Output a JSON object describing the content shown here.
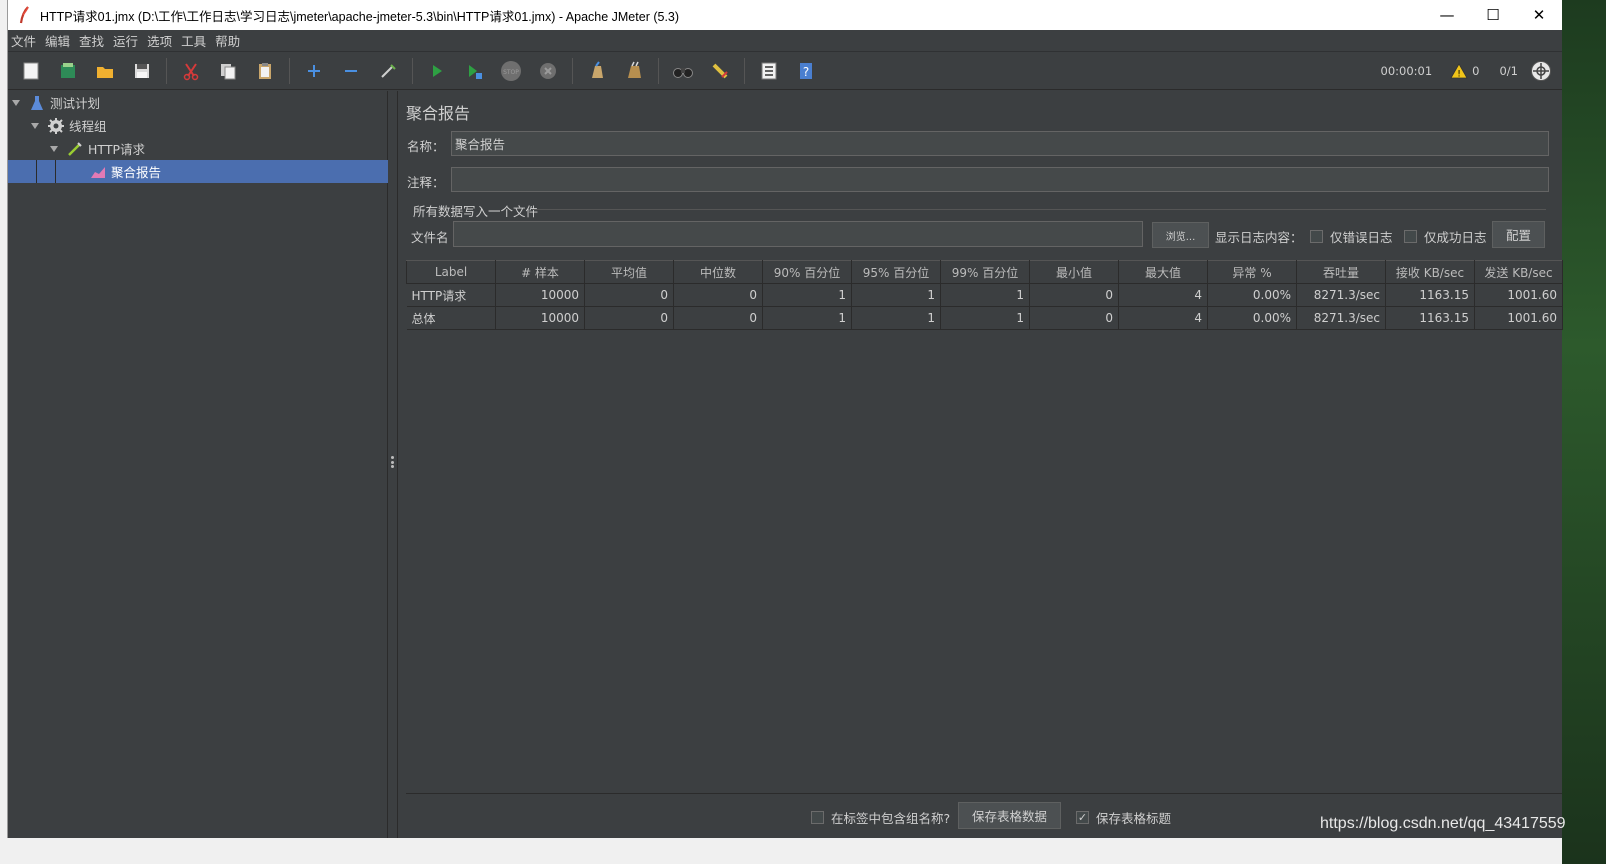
{
  "window": {
    "title": "HTTP请求01.jmx (D:\\工作\\工作日志\\学习日志\\jmeter\\apache-jmeter-5.3\\bin\\HTTP请求01.jmx) - Apache JMeter (5.3)",
    "minimize": "—",
    "maximize": "☐",
    "close": "✕"
  },
  "menu": [
    "文件",
    "编辑",
    "查找",
    "运行",
    "选项",
    "工具",
    "帮助"
  ],
  "status": {
    "timer": "00:00:01",
    "warnings": "0",
    "threads": "0/1"
  },
  "tree": {
    "test_plan": "测试计划",
    "thread_group": "线程组",
    "http_request": "HTTP请求",
    "aggregate_report": "聚合报告"
  },
  "panel": {
    "title": "聚合报告",
    "name_label": "名称：",
    "name_value": "聚合报告",
    "comment_label": "注释：",
    "comment_value": "",
    "file_group_title": "所有数据写入一个文件",
    "filename_label": "文件名",
    "filename_value": "",
    "browse_button": "浏览...",
    "log_display_label": "显示日志内容：",
    "errors_only": "仅错误日志",
    "success_only": "仅成功日志",
    "configure_button": "配置"
  },
  "table": {
    "columns": [
      "Label",
      "# 样本",
      "平均值",
      "中位数",
      "90% 百分位",
      "95% 百分位",
      "99% 百分位",
      "最小值",
      "最大值",
      "异常 %",
      "吞吐量",
      "接收 KB/sec",
      "发送 KB/sec"
    ],
    "rows": [
      [
        "HTTP请求",
        "10000",
        "0",
        "0",
        "1",
        "1",
        "1",
        "0",
        "4",
        "0.00%",
        "8271.3/sec",
        "1163.15",
        "1001.60"
      ],
      [
        "总体",
        "10000",
        "0",
        "0",
        "1",
        "1",
        "1",
        "0",
        "4",
        "0.00%",
        "8271.3/sec",
        "1163.15",
        "1001.60"
      ]
    ]
  },
  "bottom": {
    "include_group_name": "在标签中包含组名称?",
    "save_table_data": "保存表格数据",
    "save_table_header": "保存表格标题",
    "save_table_header_checked": "✓"
  },
  "watermark": "https://blog.csdn.net/qq_43417559",
  "colors": {
    "background": "#3c3f41",
    "selection": "#4b6eaf",
    "text": "#cfcfcf"
  }
}
